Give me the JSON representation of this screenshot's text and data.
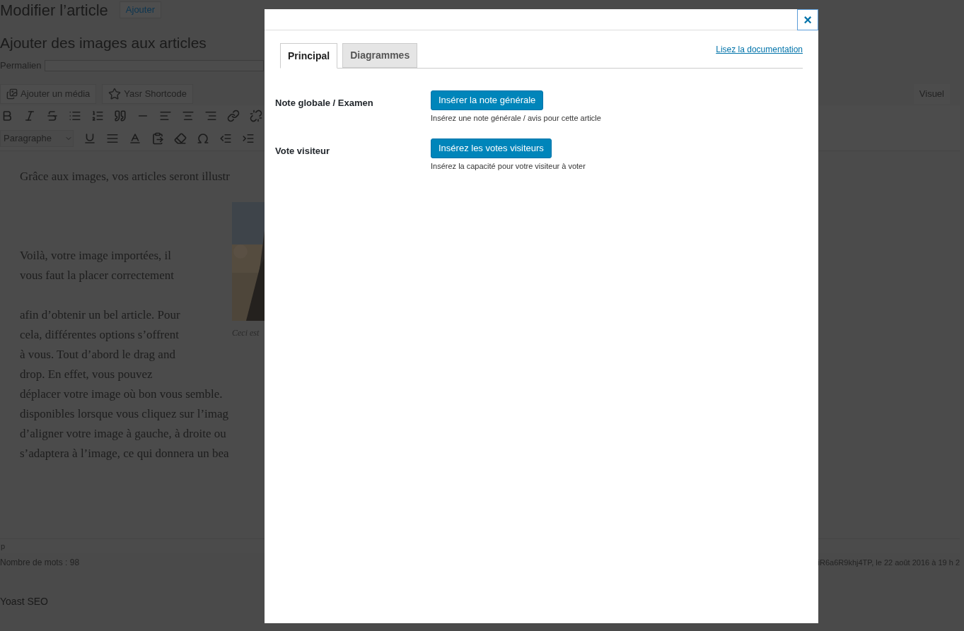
{
  "page": {
    "title": "Modifier l’article",
    "add_button": "Ajouter",
    "post_title": "Ajouter des images aux articles",
    "permalink_label": "Permalien",
    "media_buttons": [
      "Ajouter un média",
      "Yasr Shortcode"
    ],
    "editor_tab": "Visuel",
    "format_select": "Paragraphe",
    "content": {
      "intro": "Grâce aux images, vos articles seront illustr",
      "float_lines": [
        "Voilà, votre image importées, il",
        "vous faut la placer correctement"
      ],
      "wrap_lines": [
        "afin d’obtenir un bel article. Pour",
        "cela, différentes options s’offrent",
        "à vous. Tout d’abord le drag and",
        "drop. En effet, vous pouvez"
      ],
      "full_lines": [
        "déplacer votre image où bon vous semble.",
        "disponibles lorsque vous cliquez sur l’imag",
        "d’aligner votre image à gauche, à droite ou",
        "s’adaptera à l’image, ce qui donnera un bea"
      ],
      "caption": "Ceci est"
    },
    "path": "p",
    "word_count": "Nombre de mots : 98",
    "last_edit": "iR6a6R9khj4TP, le 22 août 2016 à 19 h 2",
    "yoast": "Yoast SEO"
  },
  "modal": {
    "close": "×",
    "tabs": [
      {
        "label": "Principal",
        "selected": true
      },
      {
        "label": "Diagrammes",
        "selected": false
      }
    ],
    "doc_link": "Lisez la documentation",
    "rows": [
      {
        "label": "Note globale / Examen",
        "button": "Insérer la note générale",
        "description": "Insérez une note générale / avis pour cette article"
      },
      {
        "label": "Vote visiteur",
        "button": "Insérez les votes visiteurs",
        "description": "Insérez la capacité pour votre visiteur à voter"
      }
    ]
  }
}
